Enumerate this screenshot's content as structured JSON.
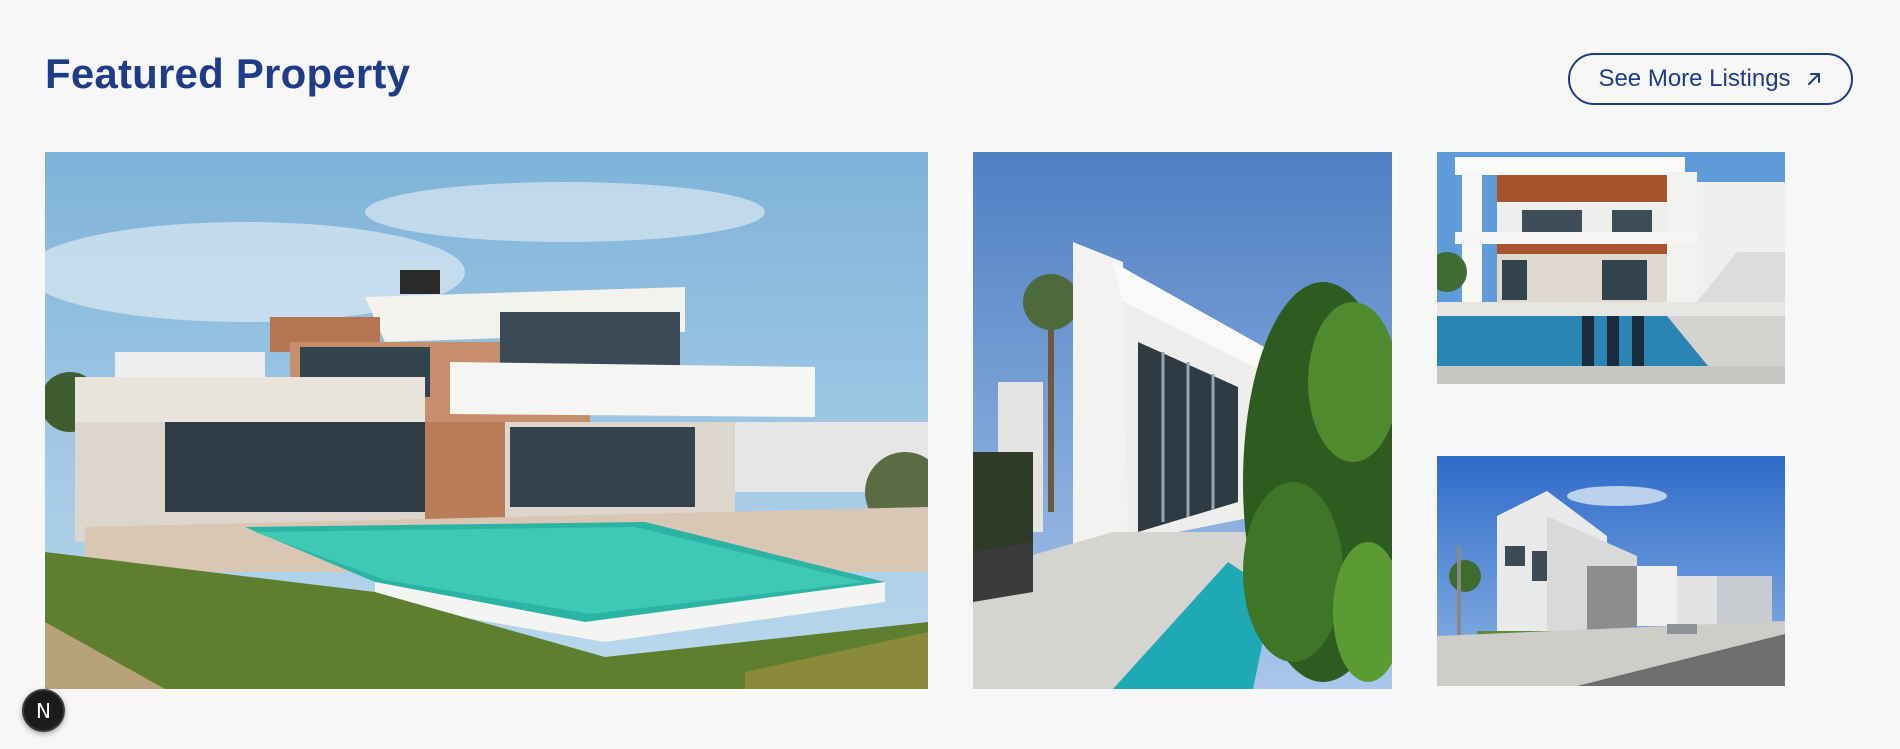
{
  "section": {
    "title": "Featured Property",
    "see_more_label": "See More Listings",
    "see_more_icon": "arrow-up-right-icon"
  },
  "gallery": [
    {
      "name": "main-property-image",
      "alt": "Modern villa with infinity pool"
    },
    {
      "name": "secondary-property-image",
      "alt": "White modern house entrance with pool and plants"
    },
    {
      "name": "thumbnail-property-image-1",
      "alt": "Modern house with pool and wooden ceiling"
    },
    {
      "name": "thumbnail-property-image-2",
      "alt": "Modern townhouses along a street"
    }
  ],
  "dev_indicator": {
    "label": "N"
  },
  "colors": {
    "accent": "#1f3c88",
    "background": "#f7f7f7"
  }
}
